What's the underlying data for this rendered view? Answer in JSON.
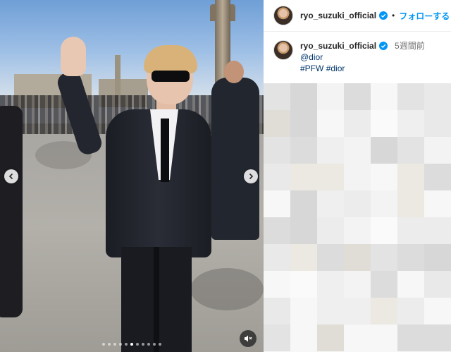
{
  "media": {
    "carousel_slides": 11,
    "active_slide": 5
  },
  "post": {
    "header_username": "ryo_suzuki_official",
    "header_separator": "•",
    "follow_label": "フォローする",
    "caption_username": "ryo_suzuki_official",
    "time_ago": "5週間前",
    "mention": "@dior",
    "hashtags": [
      "#PFW",
      "#dior"
    ]
  },
  "colors": {
    "accent": "#0095f6",
    "link": "#00376b",
    "verified": "#0095f6"
  },
  "icons": {
    "prev": "chevron-left-icon",
    "next": "chevron-right-icon",
    "mute": "speaker-muted-icon",
    "verified": "verified-badge-icon"
  }
}
